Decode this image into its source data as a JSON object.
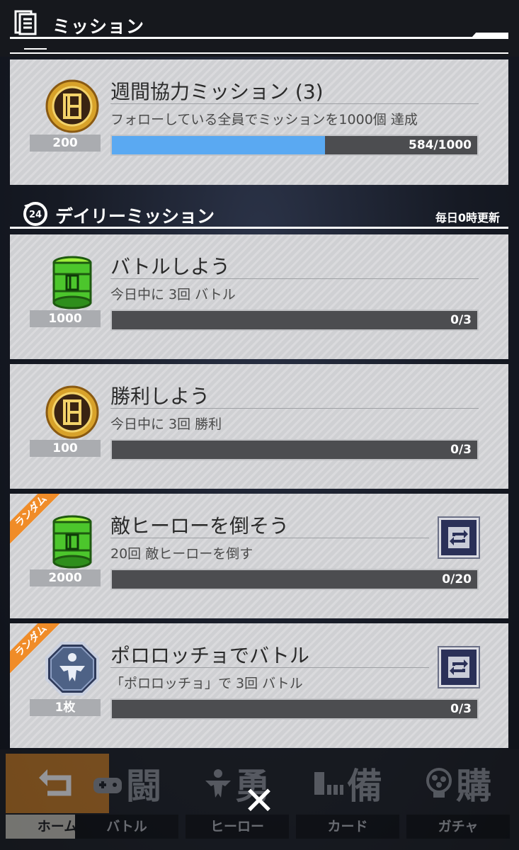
{
  "header": {
    "title": "ミッション"
  },
  "weekly": {
    "title": "週間協力ミッション (3)",
    "desc": "フォローしている全員でミッションを1000個 達成",
    "reward": "200",
    "progress_text": "584/1000",
    "progress": 0.584
  },
  "daily_section": {
    "title": "デイリーミッション",
    "note": "毎日0時更新",
    "clock_badge": "24"
  },
  "missions": [
    {
      "title": "バトルしよう",
      "desc": "今日中に 3回 バトル",
      "reward": "1000",
      "progress_text": "0/3",
      "icon": "green-can-icon"
    },
    {
      "title": "勝利しよう",
      "desc": "今日中に 3回 勝利",
      "reward": "100",
      "progress_text": "0/3",
      "icon": "gold-coin-icon"
    },
    {
      "title": "敵ヒーローを倒そう",
      "desc": "20回 敵ヒーローを倒す",
      "reward": "2000",
      "progress_text": "0/20",
      "icon": "green-can-icon",
      "badge": "ランダム"
    },
    {
      "title": "ポロロッチョでバトル",
      "desc": "「ポロロッチョ」で 3回 バトル",
      "reward": "1枚",
      "progress_text": "0/3",
      "icon": "hero-ticket-icon",
      "badge": "ランダム"
    }
  ],
  "nav": {
    "items": [
      {
        "label": "ホーム",
        "kanji": ""
      },
      {
        "label": "バトル",
        "kanji": "闘"
      },
      {
        "label": "ヒーロー",
        "kanji": "勇"
      },
      {
        "label": "カード",
        "kanji": "備"
      },
      {
        "label": "ガチャ",
        "kanji": "購"
      }
    ],
    "close": "✕"
  },
  "colors": {
    "progress_fill": "#5aa9f2",
    "ribbon": "#f08c28",
    "card": "#cfd0d3"
  }
}
